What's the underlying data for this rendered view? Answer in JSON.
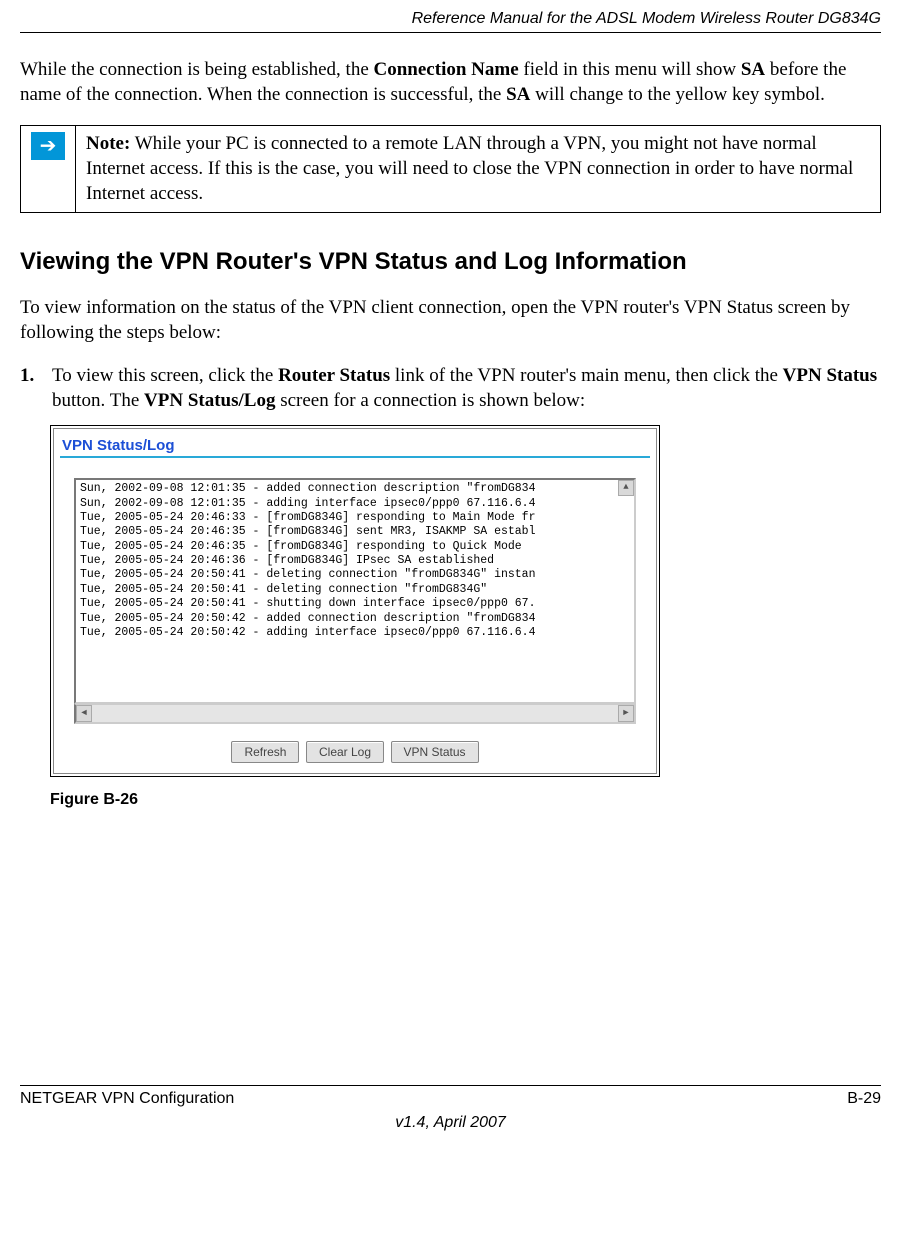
{
  "header": "Reference Manual for the ADSL Modem Wireless Router DG834G",
  "para1": {
    "pre": "While the connection is being established, the ",
    "b1": "Connection Name",
    "mid1": " field in this menu will show ",
    "b2": "SA",
    "mid2": " before the name of the connection. When the connection is successful, the ",
    "b3": "SA",
    "post": " will change to the yellow key symbol."
  },
  "note": {
    "label": "Note:",
    "text": " While your PC is connected to a remote LAN through a VPN, you might not have normal Internet access. If this is the case, you will need to close the VPN connection in order to have normal Internet access."
  },
  "heading": "Viewing the VPN Router's VPN Status and Log Information",
  "para2": "To view information on the status of the VPN client connection, open the VPN router's VPN Status screen by following the steps below:",
  "step1": {
    "num": "1.",
    "pre": "To view this screen, click the ",
    "b1": "Router Status",
    "mid1": " link of the VPN router's main menu, then click the ",
    "b2": "VPN Status",
    "mid2": " button. The ",
    "b3": "VPN Status/Log",
    "post": " screen for a connection is shown below:"
  },
  "screenshot": {
    "title": "VPN Status/Log",
    "log_lines": [
      "Sun, 2002-09-08 12:01:35 - added connection description \"fromDG834",
      "Sun, 2002-09-08 12:01:35 - adding interface ipsec0/ppp0 67.116.6.4",
      "Tue, 2005-05-24 20:46:33 - [fromDG834G] responding to Main Mode fr",
      "Tue, 2005-05-24 20:46:35 - [fromDG834G] sent MR3, ISAKMP SA establ",
      "Tue, 2005-05-24 20:46:35 - [fromDG834G] responding to Quick Mode",
      "Tue, 2005-05-24 20:46:36 - [fromDG834G] IPsec SA established",
      "Tue, 2005-05-24 20:50:41 - deleting connection \"fromDG834G\" instan",
      "Tue, 2005-05-24 20:50:41 - deleting connection \"fromDG834G\"",
      "Tue, 2005-05-24 20:50:41 - shutting down interface ipsec0/ppp0 67.",
      "Tue, 2005-05-24 20:50:42 - added connection description \"fromDG834",
      "Tue, 2005-05-24 20:50:42 - adding interface ipsec0/ppp0 67.116.6.4"
    ],
    "buttons": {
      "refresh": "Refresh",
      "clear": "Clear Log",
      "status": "VPN Status"
    }
  },
  "figure_caption": "Figure B-26",
  "footer": {
    "left": "NETGEAR VPN Configuration",
    "right": "B-29",
    "version": "v1.4, April 2007"
  }
}
